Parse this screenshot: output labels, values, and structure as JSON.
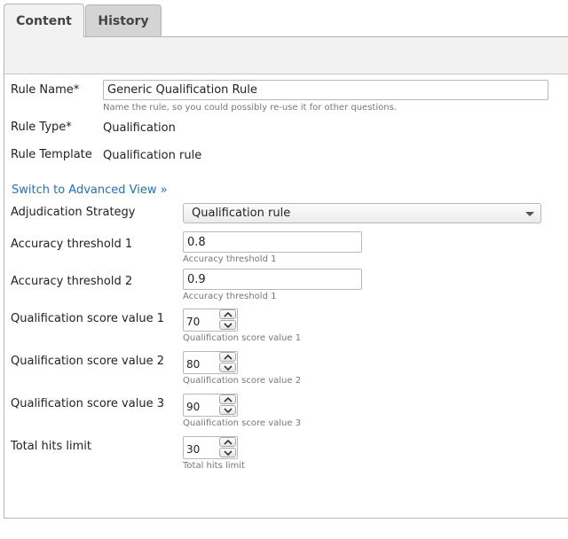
{
  "tabs": {
    "content": "Content",
    "history": "History"
  },
  "rule_name": {
    "label": "Rule Name*",
    "value": "Generic Qualification Rule",
    "hint": "Name the rule, so you could possibly re-use it for other questions."
  },
  "rule_type": {
    "label": "Rule Type*",
    "value": "Qualification"
  },
  "rule_template": {
    "label": "Rule Template",
    "value": "Qualification rule"
  },
  "advanced_link": "Switch to Advanced View »",
  "adjudication": {
    "label": "Adjudication Strategy",
    "selected": "Qualification rule"
  },
  "accuracy1": {
    "label": "Accuracy threshold 1",
    "value": "0.8",
    "hint": "Accuracy threshold 1"
  },
  "accuracy2": {
    "label": "Accuracy threshold 2",
    "value": "0.9",
    "hint": "Accuracy threshold 1"
  },
  "qual1": {
    "label": "Qualification score value 1",
    "value": "70",
    "hint": "Qualification score value 1"
  },
  "qual2": {
    "label": "Qualification score value 2",
    "value": "80",
    "hint": "Qualification score value 2"
  },
  "qual3": {
    "label": "Qualification score value 3",
    "value": "90",
    "hint": "Qualification score value 3"
  },
  "hits": {
    "label": "Total hits limit",
    "value": "30",
    "hint": "Total hits limit"
  },
  "icons": {
    "spin_up": "chevron-up-icon",
    "spin_down": "chevron-down-icon",
    "dropdown": "caret-down-icon"
  }
}
